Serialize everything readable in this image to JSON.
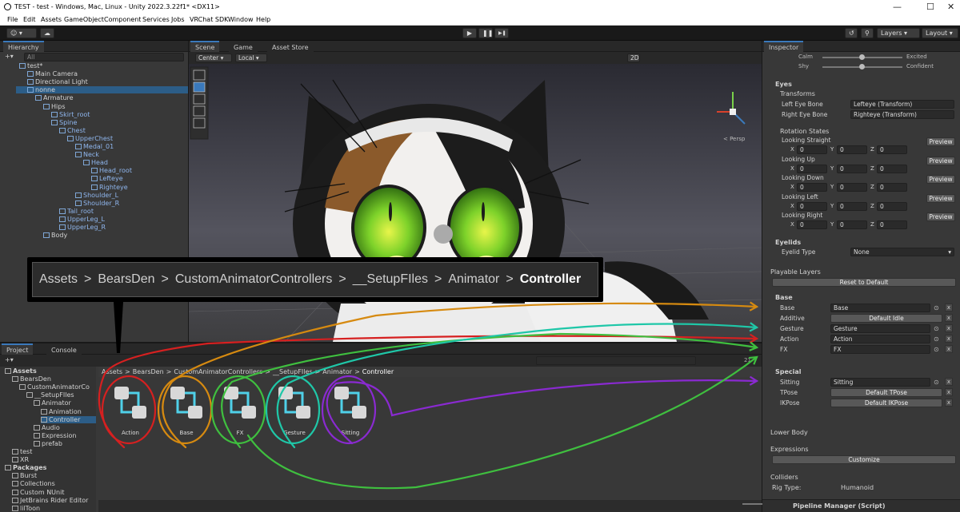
{
  "window": {
    "title": "TEST - test - Windows, Mac, Linux - Unity 2022.3.22f1* <DX11>",
    "minimize": "—",
    "maximize": "☐",
    "close": "✕"
  },
  "menu": [
    "File",
    "Edit",
    "Assets",
    "GameObject",
    "Component",
    "Services",
    "Jobs",
    "VRChat SDK",
    "Window",
    "Help"
  ],
  "toolbar": {
    "layers": "Layers",
    "layout": "Layout",
    "play": "▶",
    "pause": "❚❚",
    "step": "▶❚"
  },
  "hierarchy": {
    "tab": "Hierarchy",
    "search_placeholder": "All",
    "items": [
      {
        "label": "test*",
        "depth": 0
      },
      {
        "label": "Main Camera",
        "depth": 1
      },
      {
        "label": "Directional Light",
        "depth": 1
      },
      {
        "label": "nonne",
        "depth": 1
      },
      {
        "label": "Armature",
        "depth": 2
      },
      {
        "label": "Hips",
        "depth": 3
      },
      {
        "label": "Skirt_root",
        "depth": 4
      },
      {
        "label": "Spine",
        "depth": 4
      },
      {
        "label": "Chest",
        "depth": 5
      },
      {
        "label": "UpperChest",
        "depth": 6
      },
      {
        "label": "Medal_01",
        "depth": 7
      },
      {
        "label": "Neck",
        "depth": 7
      },
      {
        "label": "Head",
        "depth": 8
      },
      {
        "label": "Head_root",
        "depth": 9
      },
      {
        "label": "Lefteye",
        "depth": 9
      },
      {
        "label": "Righteye",
        "depth": 9
      },
      {
        "label": "Shoulder_L",
        "depth": 7
      },
      {
        "label": "Shoulder_R",
        "depth": 7
      },
      {
        "label": "Tail_root",
        "depth": 5
      },
      {
        "label": "UpperLeg_L",
        "depth": 5
      },
      {
        "label": "UpperLeg_R",
        "depth": 5
      },
      {
        "label": "Body",
        "depth": 3
      }
    ]
  },
  "scene": {
    "tabs": [
      "Scene",
      "Game",
      "Asset Store"
    ],
    "pivot": "Center",
    "space": "Local",
    "mode_2d": "2D",
    "persp": "< Persp"
  },
  "breadcrumb_callout": [
    "Assets",
    ">",
    "BearsDen",
    ">",
    "CustomAnimatorControllers",
    ">",
    "__SetupFIles",
    ">",
    "Animator",
    ">",
    "Controller"
  ],
  "project": {
    "tabs": [
      "Project",
      "Console"
    ],
    "count": "21",
    "tree": [
      {
        "label": "Assets",
        "depth": 0,
        "bold": true
      },
      {
        "label": "BearsDen",
        "depth": 1
      },
      {
        "label": "CustomAnimatorCo",
        "depth": 2
      },
      {
        "label": "__SetupFIles",
        "depth": 3
      },
      {
        "label": "Animator",
        "depth": 4
      },
      {
        "label": "Animation",
        "depth": 5
      },
      {
        "label": "Controller",
        "depth": 5
      },
      {
        "label": "Audio",
        "depth": 4
      },
      {
        "label": "Expression",
        "depth": 4
      },
      {
        "label": "prefab",
        "depth": 4
      },
      {
        "label": "test",
        "depth": 1
      },
      {
        "label": "XR",
        "depth": 1
      },
      {
        "label": "Packages",
        "depth": 0,
        "bold": true
      },
      {
        "label": "Burst",
        "depth": 1
      },
      {
        "label": "Collections",
        "depth": 1
      },
      {
        "label": "Custom NUnit",
        "depth": 1
      },
      {
        "label": "JetBrains Rider Editor",
        "depth": 1
      },
      {
        "label": "lilToon",
        "depth": 1
      }
    ],
    "path": [
      "Assets",
      ">",
      "BearsDen",
      ">",
      "CustomAnimatorControllers",
      ">",
      "__SetupFIles",
      ">",
      "Animator",
      ">",
      "Controller"
    ],
    "assets": [
      "Action",
      "Base",
      "FX",
      "Gesture",
      "Sitting"
    ]
  },
  "inspector": {
    "tab": "Inspector",
    "sliders": [
      {
        "left": "Calm",
        "right": "Excited",
        "value": 0.5
      },
      {
        "left": "Shy",
        "right": "Confident",
        "value": 0.5
      }
    ],
    "eyes": {
      "title": "Eyes",
      "transforms": "Transforms",
      "left_label": "Left Eye Bone",
      "left_value": "Lefteye (Transform)",
      "right_label": "Right Eye Bone",
      "right_value": "Righteye (Transform)"
    },
    "rotation": {
      "title": "Rotation States",
      "preview": "Preview",
      "states": [
        {
          "label": "Looking Straight",
          "x": "0",
          "y": "0",
          "z": "0"
        },
        {
          "label": "Looking Up",
          "x": "0",
          "y": "0",
          "z": "0"
        },
        {
          "label": "Looking Down",
          "x": "0",
          "y": "0",
          "z": "0"
        },
        {
          "label": "Looking Left",
          "x": "0",
          "y": "0",
          "z": "0"
        },
        {
          "label": "Looking Right",
          "x": "0",
          "y": "0",
          "z": "0"
        }
      ]
    },
    "eyelids": {
      "title": "Eyelids",
      "type_label": "Eyelid Type",
      "type_value": "None"
    },
    "playable": {
      "title": "Playable Layers",
      "reset": "Reset to Default",
      "base_title": "Base",
      "base": [
        {
          "label": "Base",
          "value": "Base",
          "kind": "field"
        },
        {
          "label": "Additive",
          "value": "Default Idle",
          "kind": "button"
        },
        {
          "label": "Gesture",
          "value": "Gesture",
          "kind": "field"
        },
        {
          "label": "Action",
          "value": "Action",
          "kind": "field"
        },
        {
          "label": "FX",
          "value": "FX",
          "kind": "field"
        }
      ],
      "special_title": "Special",
      "special": [
        {
          "label": "Sitting",
          "value": "Sitting",
          "kind": "field"
        },
        {
          "label": "TPose",
          "value": "Default TPose",
          "kind": "button"
        },
        {
          "label": "IKPose",
          "value": "Default IKPose",
          "kind": "button"
        }
      ]
    },
    "lower_body": "Lower Body",
    "expressions": {
      "title": "Expressions",
      "button": "Customize"
    },
    "colliders": {
      "title": "Colliders",
      "rig_label": "Rig Type:",
      "rig_value": "Humanoid"
    },
    "footer": "Pipeline Manager (Script)"
  },
  "colors": {
    "accent": "#3a79bb",
    "red": "#d62020",
    "orange": "#d68a10",
    "green": "#3fbf3f",
    "teal": "#1fc7a8",
    "purple": "#8a2ad1"
  }
}
